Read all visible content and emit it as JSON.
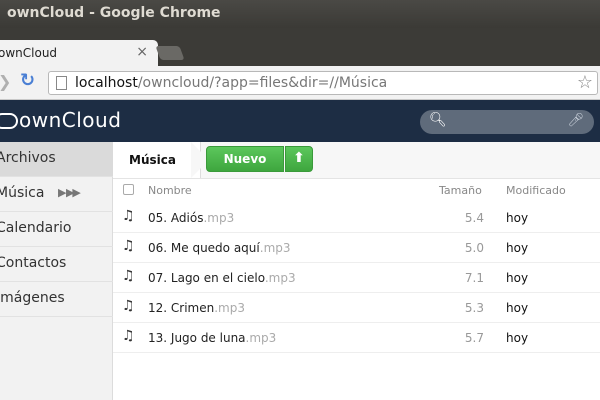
{
  "window": {
    "title": "ownCloud - Google Chrome",
    "minimize_glyph": "—"
  },
  "tab": {
    "title": "ownCloud",
    "close_glyph": "×"
  },
  "toolbar": {
    "url_host": "localhost",
    "url_path": "/owncloud/?app=files&dir=//Música"
  },
  "header": {
    "logo_text": "ownCloud"
  },
  "sidebar": {
    "items": [
      {
        "label": "Archivos",
        "active": true
      },
      {
        "label": "Música",
        "active": false
      },
      {
        "label": "Calendario",
        "active": false
      },
      {
        "label": "Contactos",
        "active": false
      },
      {
        "label": "Imágenes",
        "active": false
      }
    ]
  },
  "controls": {
    "breadcrumb": "Música",
    "new_label": "Nuevo"
  },
  "list": {
    "headers": {
      "name": "Nombre",
      "size": "Tamaño",
      "modified": "Modificado"
    },
    "files": [
      {
        "name": "05. Adiós",
        "ext": ".mp3",
        "size": "5.4",
        "modified": "hoy"
      },
      {
        "name": "06. Me quedo aquí",
        "ext": ".mp3",
        "size": "5.0",
        "modified": "hoy"
      },
      {
        "name": "07. Lago en el cielo",
        "ext": ".mp3",
        "size": "7.1",
        "modified": "hoy"
      },
      {
        "name": "12. Crimen",
        "ext": ".mp3",
        "size": "5.3",
        "modified": "hoy"
      },
      {
        "name": "13. Jugo de luna",
        "ext": ".mp3",
        "size": "5.7",
        "modified": "hoy"
      }
    ]
  },
  "colors": {
    "header_bg": "#1d2d44",
    "new_button": "#4cb84c",
    "reload": "#4a7fd4"
  }
}
